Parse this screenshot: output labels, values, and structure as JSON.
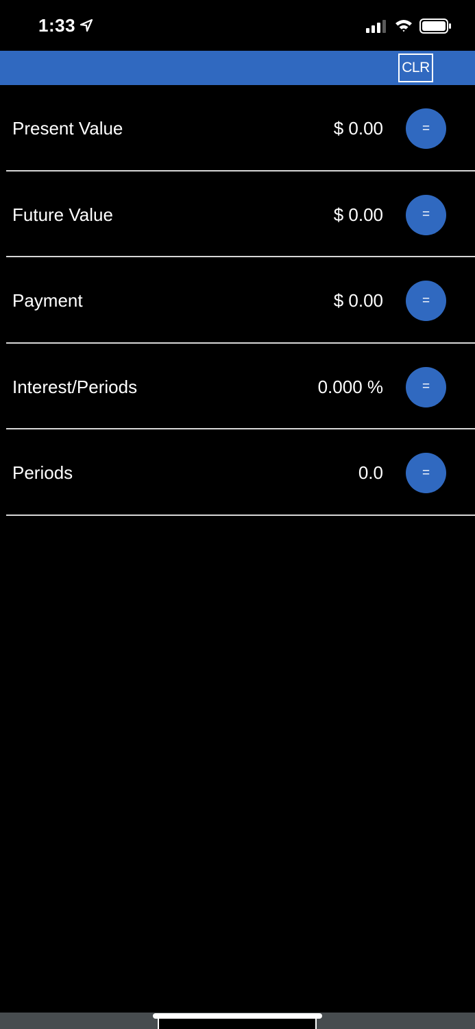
{
  "status_bar": {
    "time": "1:33",
    "icons": [
      "location-arrow-icon",
      "cellular-signal-icon",
      "wifi-icon",
      "battery-icon"
    ]
  },
  "nav_bar": {
    "clear_label": "CLR",
    "color": "#3069c0"
  },
  "rows": [
    {
      "label": "Present Value",
      "value": "$ 0.00",
      "button": "="
    },
    {
      "label": "Future Value",
      "value": "$ 0.00",
      "button": "="
    },
    {
      "label": "Payment",
      "value": "$ 0.00",
      "button": "="
    },
    {
      "label": "Interest/Periods",
      "value": "0.000 %",
      "button": "="
    },
    {
      "label": "Periods",
      "value": "0.0",
      "button": "="
    }
  ],
  "colors": {
    "background": "#000000",
    "accent": "#3069c0",
    "divider": "#d8d8d8",
    "bottom_bar": "#474c4f"
  }
}
